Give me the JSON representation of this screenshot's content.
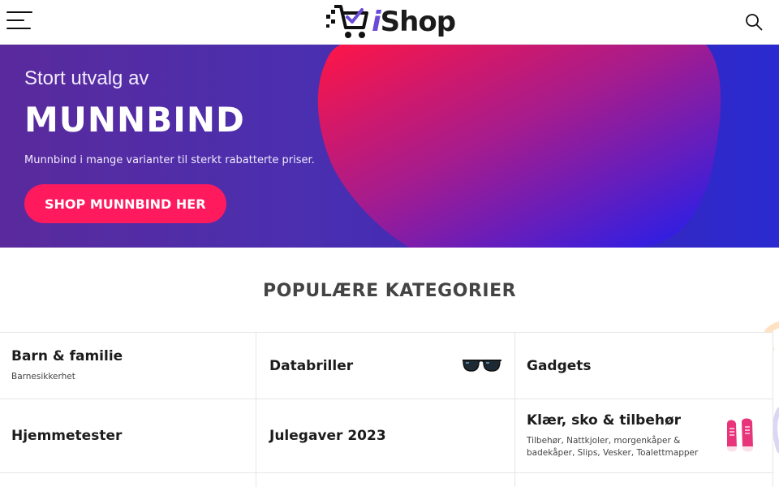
{
  "header": {
    "menu_icon": "hamburger-menu-icon",
    "logo_text_i": "i",
    "logo_text_rest": "Shop",
    "search_icon": "search-icon"
  },
  "hero": {
    "subtitle": "Stort utvalg av",
    "title": "MUNNBIND",
    "description": "Munnbind i mange varianter til sterkt rabatterte priser.",
    "cta_label": "SHOP MUNNBIND HER",
    "cta_color": "#ff1a5e"
  },
  "categories": {
    "heading": "POPULÆRE KATEGORIER",
    "items": [
      {
        "title": "Barn & familie",
        "subtitle": "Barnesikkerhet"
      },
      {
        "title": "Databriller",
        "icon": "glasses-icon"
      },
      {
        "title": "Gadgets"
      },
      {
        "title": "Hjemmetester"
      },
      {
        "title": "Julegaver 2023"
      },
      {
        "title": "Klær, sko & tilbehør",
        "subtitle": "Tilbehør, Nattkjoler, morgenkåper & badekåper, Slips, Vesker, Toalettmapper",
        "icon": "pink-sneakers-icon"
      }
    ]
  }
}
